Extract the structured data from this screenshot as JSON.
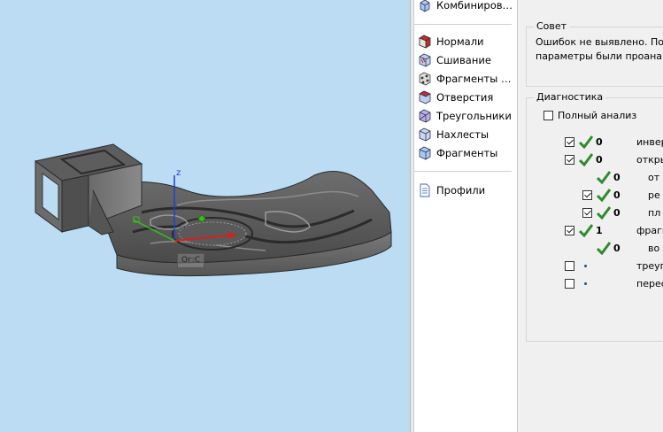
{
  "viewport": {
    "axis_z": "z",
    "orc_label": "Ог:С"
  },
  "tree": {
    "combine": "Комбиниров…",
    "items": [
      {
        "label": "Нормали",
        "icon": "normals-icon"
      },
      {
        "label": "Сшивание",
        "icon": "stitching-icon"
      },
      {
        "label": "Фрагменты …",
        "icon": "fragments-dots-icon"
      },
      {
        "label": "Отверстия",
        "icon": "holes-icon"
      },
      {
        "label": "Треугольники",
        "icon": "triangles-icon"
      },
      {
        "label": "Нахлесты",
        "icon": "overlaps-icon"
      },
      {
        "label": "Фрагменты",
        "icon": "fragments-icon"
      }
    ],
    "profiles": "Профили"
  },
  "advice": {
    "title": "Совет",
    "line1": "Ошибок не выявлено. По",
    "line2": "параметры были проана"
  },
  "diagnostics": {
    "title": "Диагностика",
    "full_analysis": "Полный анализ",
    "rows": [
      {
        "count": "0",
        "label": "инвер"
      },
      {
        "count": "0",
        "label": "откры"
      },
      {
        "count": "0",
        "label": "от"
      },
      {
        "count": "0",
        "label": "ре"
      },
      {
        "count": "0",
        "label": "пл"
      },
      {
        "count": "1",
        "label": "фрагм"
      },
      {
        "count": "0",
        "label": "во"
      },
      {
        "count": "",
        "label": "треуго"
      },
      {
        "count": "",
        "label": "перес"
      }
    ]
  },
  "colors": {
    "viewport_bg": "#bcdcf4",
    "ok_green": "#2e8b2e",
    "axis_x": "#d42020",
    "axis_y": "#34c01a",
    "axis_z": "#2040d0"
  }
}
